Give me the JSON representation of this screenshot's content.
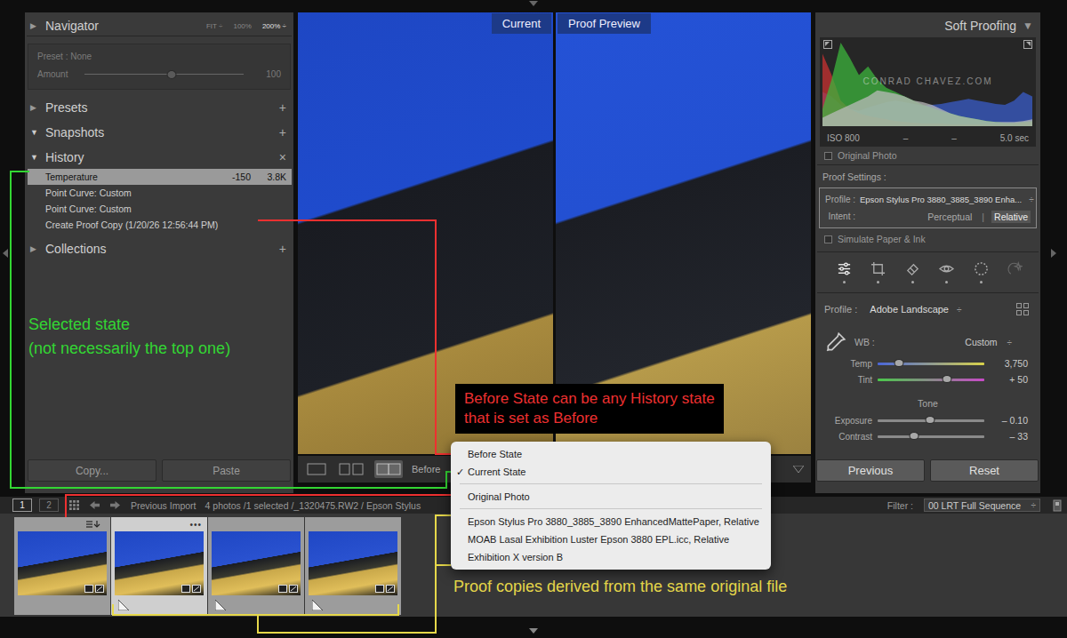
{
  "left_panel": {
    "navigator": {
      "arrow": "▶",
      "expanded": false,
      "title": "Navigator",
      "zoom": [
        {
          "label": "FIT ÷",
          "selected": false
        },
        {
          "label": "100%",
          "selected": false
        },
        {
          "label": "200% ÷",
          "selected": true
        }
      ]
    },
    "quick_develop": {
      "preset": "Preset : None",
      "amount_label": "Amount",
      "amount_value": "100",
      "level": 0.55,
      "disabled": true
    },
    "sections": [
      {
        "arrow": "▶",
        "expanded": false,
        "title": "Presets",
        "action": "+",
        "items": []
      },
      {
        "arrow": "▼",
        "expanded": true,
        "title": "Snapshots",
        "action": "+",
        "items": []
      },
      {
        "arrow": "▼",
        "expanded": true,
        "title": "History",
        "action": "×",
        "items": [
          {
            "label": "Temperature",
            "values": [
              "-150",
              "3.8K"
            ],
            "selected": true
          },
          {
            "label": "Point Curve: Custom",
            "values": [],
            "selected": false
          },
          {
            "label": "Point Curve: Custom",
            "values": [],
            "selected": false
          },
          {
            "label": "Create Proof Copy (1/20/26 12:56:44 PM)",
            "values": [],
            "selected": false
          }
        ]
      },
      {
        "arrow": "▶",
        "expanded": false,
        "title": "Collections",
        "action": "+",
        "items": []
      }
    ],
    "buttons": [
      "Copy...",
      "Paste"
    ]
  },
  "center": {
    "views": [
      {
        "label": "Current"
      },
      {
        "label": "Proof Preview"
      }
    ],
    "toolbar": {
      "view_modes": [
        {
          "kind": "loupe",
          "selected": false
        },
        {
          "kind": "compare",
          "selected": false
        },
        {
          "kind": "before-after",
          "selected": true
        }
      ],
      "before_label": "Before"
    }
  },
  "menu": {
    "check": "✓",
    "groups": [
      [
        {
          "label": "Before State",
          "checked": false
        },
        {
          "label": "Current State",
          "checked": true
        }
      ],
      [
        {
          "label": "Original Photo",
          "checked": false
        }
      ],
      [
        {
          "label": "Epson Stylus Pro 3880_3885_3890 EnhancedMattePaper, Relative",
          "checked": false
        },
        {
          "label": "MOAB Lasal Exhibition Luster Epson 3880 EPL.icc, Relative",
          "checked": false
        },
        {
          "label": "Exhibition X version B",
          "checked": false
        }
      ]
    ]
  },
  "right_panel": {
    "title": "Soft Proofing",
    "arrow": "▼",
    "histogram": {
      "watermark": "CONRAD CHAVEZ.COM",
      "series": [
        {
          "color": "#3a5cc8",
          "values": [
            40,
            35,
            25,
            20,
            18,
            22,
            25,
            28,
            30,
            28,
            26,
            24,
            25,
            26,
            28,
            30,
            32,
            30,
            28,
            26,
            25,
            30,
            40,
            35
          ]
        },
        {
          "color": "#c83232",
          "values": [
            85,
            60,
            30,
            20,
            15,
            12,
            10,
            8,
            6,
            5,
            4,
            3,
            3,
            3,
            2,
            2,
            2,
            2,
            2,
            2,
            2,
            3,
            4,
            5
          ]
        },
        {
          "color": "#3cb43c",
          "values": [
            20,
            55,
            98,
            80,
            60,
            70,
            55,
            45,
            40,
            35,
            30,
            25,
            22,
            18,
            15,
            12,
            10,
            8,
            6,
            5,
            4,
            4,
            5,
            6
          ]
        },
        {
          "color": "#bbbbbb",
          "values": [
            10,
            15,
            20,
            25,
            30,
            35,
            42,
            40,
            38,
            35,
            30,
            28,
            25,
            20,
            15,
            12,
            10,
            8,
            6,
            5,
            5,
            5,
            6,
            8
          ]
        }
      ],
      "stats": [
        "ISO 800",
        "–",
        "–",
        "5.0 sec"
      ],
      "original_photo": {
        "label": "Original Photo",
        "checked": false
      }
    },
    "proof_settings": {
      "title": "Proof Settings :",
      "profile_label": "Profile :",
      "profile_value": "Epson Stylus Pro 3880_3885_3890 Enha...",
      "stepper": "÷",
      "intent_label": "Intent :",
      "separator": "|",
      "intents": [
        {
          "label": "Perceptual",
          "selected": false
        },
        {
          "label": "Relative",
          "selected": true
        }
      ]
    },
    "simulate": {
      "label": "Simulate Paper & Ink",
      "checked": false
    },
    "tools": [
      {
        "kind": "edit",
        "selected": true,
        "dot": true,
        "disabled": false
      },
      {
        "kind": "crop",
        "selected": false,
        "dot": true,
        "disabled": false
      },
      {
        "kind": "heal",
        "selected": false,
        "dot": true,
        "disabled": false
      },
      {
        "kind": "red-eye",
        "selected": false,
        "dot": true,
        "disabled": false
      },
      {
        "kind": "mask",
        "selected": false,
        "dot": true,
        "disabled": false
      },
      {
        "kind": "ai-edit",
        "selected": false,
        "dot": false,
        "disabled": true
      }
    ],
    "profile": {
      "label": "Profile :",
      "value": "Adobe Landscape",
      "stepper": "÷"
    },
    "wb": {
      "label": "WB :",
      "value": "Custom",
      "stepper": "÷"
    },
    "wb_sliders": [
      {
        "label": "Temp",
        "value": "3,750",
        "level": 0.2,
        "color_from": "#4a66d8",
        "color_to": "#d8d24a"
      },
      {
        "label": "Tint",
        "value": "+ 50",
        "level": 0.65,
        "color_from": "#4ac84a",
        "color_to": "#c84ac8"
      }
    ],
    "tone": {
      "title": "Tone",
      "sliders": [
        {
          "label": "Exposure",
          "value": "– 0.10",
          "level": 0.49,
          "color_from": "#8a8a8a",
          "color_to": "#8a8a8a"
        },
        {
          "label": "Contrast",
          "value": "– 33",
          "level": 0.34,
          "color_from": "#8a8a8a",
          "color_to": "#8a8a8a"
        }
      ]
    },
    "buttons": [
      "Previous",
      "Reset"
    ]
  },
  "filmstrip_bar": {
    "screens": [
      {
        "label": "1",
        "selected": true
      },
      {
        "label": "2",
        "selected": false
      }
    ],
    "source": "Previous Import",
    "path": "4 photos /1 selected /_1320475.RW2 / Epson Stylus",
    "filter_label": "Filter :",
    "filter_value": "00 LRT Full Sequence",
    "stepper": "÷"
  },
  "filmstrip": [
    {
      "kind": "original",
      "selected": false,
      "more": ""
    },
    {
      "kind": "proof-copy",
      "selected": true,
      "more": "•••"
    },
    {
      "kind": "proof-copy",
      "selected": false,
      "more": ""
    },
    {
      "kind": "proof-copy",
      "selected": false,
      "more": ""
    }
  ],
  "annotations": {
    "selected_state": {
      "lines": [
        "Selected state",
        "(not necessarily the top one)"
      ],
      "color": "#33d633"
    },
    "before_state": {
      "lines": [
        "Before State can be any History state",
        "that is set as Before"
      ],
      "color": "#ee3030"
    },
    "proof_copies": {
      "lines": [
        "Proof copies derived from the same original file"
      ],
      "color": "#e6d84a"
    }
  }
}
